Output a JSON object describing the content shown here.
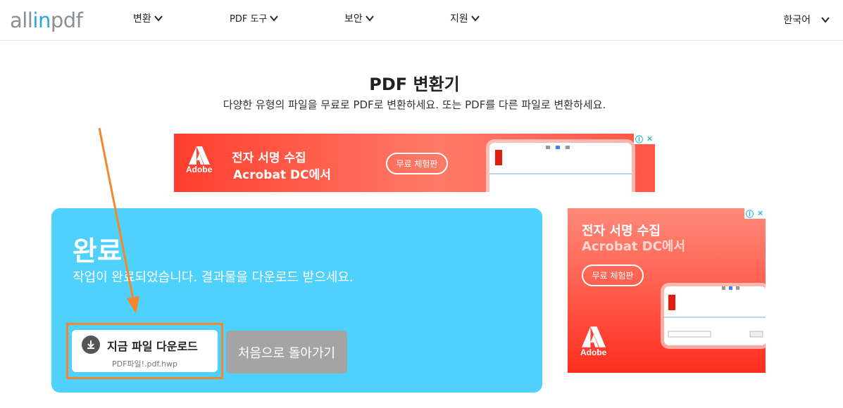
{
  "header": {
    "logo": {
      "part1": "all",
      "part2": "in",
      "part3": "pdf"
    },
    "nav": [
      {
        "label": "변환"
      },
      {
        "label": "PDF 도구"
      },
      {
        "label": "보안"
      },
      {
        "label": "지원"
      }
    ],
    "language": "한국어"
  },
  "hero": {
    "title": "PDF 변환기",
    "subtitle": "다양한 유형의 파일을 무료로 PDF로 변환하세요. 또는 PDF를 다른 파일로 변환하세요."
  },
  "ad_top": {
    "brand": "Adobe",
    "line1": "전자 서명 수집",
    "line2": "Acrobat DC에서",
    "cta": "무료 체험판"
  },
  "result": {
    "heading": "완료",
    "message": "작업이 완료되었습니다. 결과물을 다운로드 받으세요.",
    "download_label": "지금 파일 다운로드",
    "filename": "PDF파일!.pdf.hwp",
    "back_label": "처음으로 돌아가기"
  },
  "ad_side": {
    "brand": "Adobe",
    "line1": "전자 서명 수집",
    "line2": "Acrobat DC에서",
    "cta": "무료 체험판"
  },
  "colors": {
    "panel": "#4fd1fd",
    "accent_orange": "#f5862a",
    "back_button": "#a4a4a4",
    "ad_red": "#ff3e2d"
  }
}
